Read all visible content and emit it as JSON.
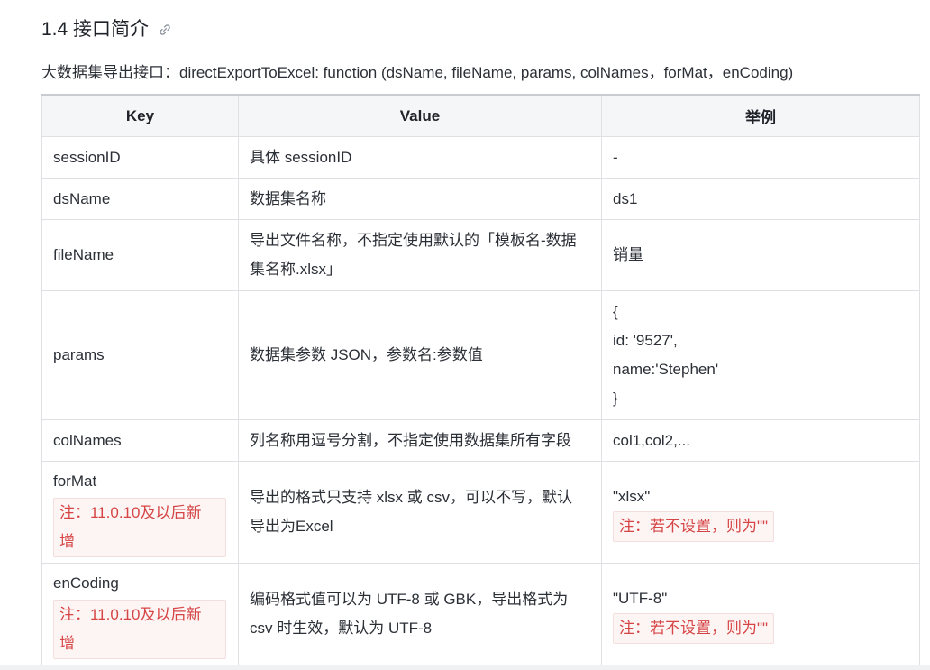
{
  "heading": {
    "title": "1.4 接口简介",
    "icon": "link-icon"
  },
  "intro": "大数据集导出接口：directExportToExcel: function (dsName, fileName, params, colNames，forMat，enCoding)",
  "table": {
    "headers": [
      "Key",
      "Value",
      "举例"
    ],
    "rows": [
      {
        "key": "sessionID",
        "value": "具体 sessionID",
        "example": "-"
      },
      {
        "key": "dsName",
        "value": "数据集名称",
        "example": "ds1"
      },
      {
        "key": "fileName",
        "value_lines": [
          "导出文件名称，不指定使用默认的「模板名-数据",
          "集名称.xlsx」"
        ],
        "example": "销量"
      },
      {
        "key": "params",
        "value": "数据集参数 JSON，参数名:参数值",
        "example_lines": [
          "{",
          "id: '9527',",
          "name:'Stephen'",
          "}"
        ]
      },
      {
        "key": "colNames",
        "value": "列名称用逗号分割，不指定使用数据集所有字段",
        "example": "col1,col2,..."
      },
      {
        "key": "forMat",
        "key_note_lines": [
          "注：11.0.10及以后新",
          "增"
        ],
        "value_lines": [
          "导出的格式只支持 xlsx 或 csv，可以不写，默认",
          "导出为Excel"
        ],
        "example": "\"xlsx\"",
        "example_note": "注：若不设置，则为\"\""
      },
      {
        "key": "enCoding",
        "key_note_lines": [
          "注：11.0.10及以后新",
          "增"
        ],
        "value_lines": [
          "编码格式值可以为 UTF-8 或 GBK，导出格式为",
          "csv 时生效，默认为 UTF-8"
        ],
        "example": "\"UTF-8\"",
        "example_note": "注：若不设置，则为\"\""
      }
    ]
  }
}
